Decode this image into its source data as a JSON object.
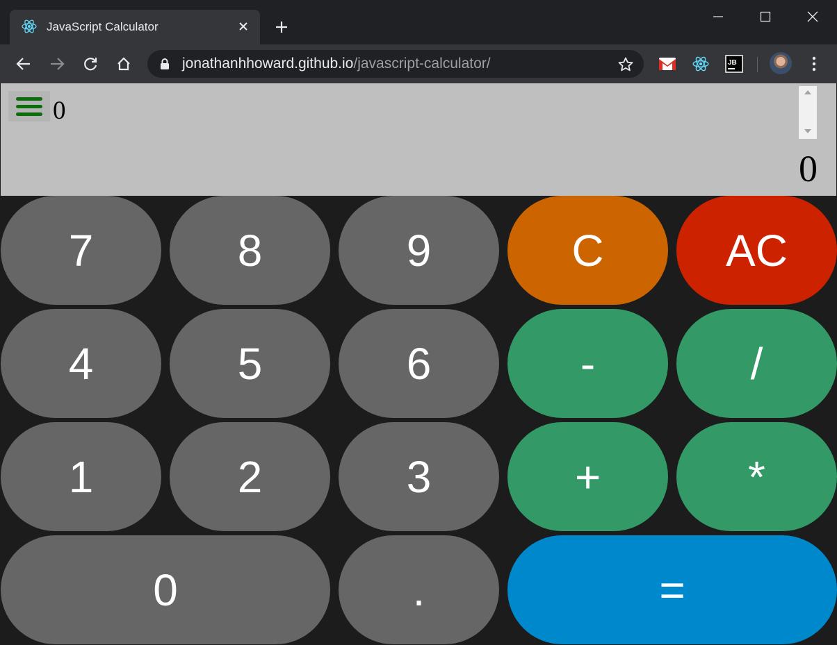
{
  "browser": {
    "tab_title": "JavaScript Calculator",
    "url_host": "jonathanhhoward.github.io",
    "url_path": "/javascript-calculator/",
    "icons": {
      "favicon": "react-icon",
      "tab_close": "close-icon",
      "new_tab": "plus-icon",
      "minimize": "minimize-icon",
      "maximize": "maximize-icon",
      "close_window": "close-icon",
      "back": "arrow-left-icon",
      "forward": "arrow-right-icon",
      "reload": "reload-icon",
      "home": "home-icon",
      "lock": "lock-icon",
      "bookmark": "star-icon",
      "extensions": [
        "gmail-icon",
        "react-devtools-icon",
        "jetbrains-icon"
      ],
      "profile": "avatar",
      "menu": "kebab-menu-icon"
    }
  },
  "calculator": {
    "history_value": "0",
    "display_value": "0",
    "keys": [
      {
        "label": "7",
        "name": "key-7"
      },
      {
        "label": "8",
        "name": "key-8"
      },
      {
        "label": "9",
        "name": "key-9"
      },
      {
        "label": "C",
        "name": "clear-button"
      },
      {
        "label": "AC",
        "name": "all-clear-button"
      },
      {
        "label": "4",
        "name": "key-4"
      },
      {
        "label": "5",
        "name": "key-5"
      },
      {
        "label": "6",
        "name": "key-6"
      },
      {
        "label": "-",
        "name": "subtract-button"
      },
      {
        "label": "/",
        "name": "divide-button"
      },
      {
        "label": "1",
        "name": "key-1"
      },
      {
        "label": "2",
        "name": "key-2"
      },
      {
        "label": "3",
        "name": "key-3"
      },
      {
        "label": "+",
        "name": "add-button"
      },
      {
        "label": "*",
        "name": "multiply-button"
      },
      {
        "label": "0",
        "name": "key-0"
      },
      {
        "label": ".",
        "name": "decimal-button"
      },
      {
        "label": "=",
        "name": "equals-button"
      }
    ],
    "colors": {
      "number": "#666666",
      "clear": "#cc6500",
      "all_clear": "#cc2200",
      "operator": "#339966",
      "equals": "#0088cc",
      "display_bg": "#bfbfbf",
      "menu_icon": "#0b6e0b"
    }
  }
}
